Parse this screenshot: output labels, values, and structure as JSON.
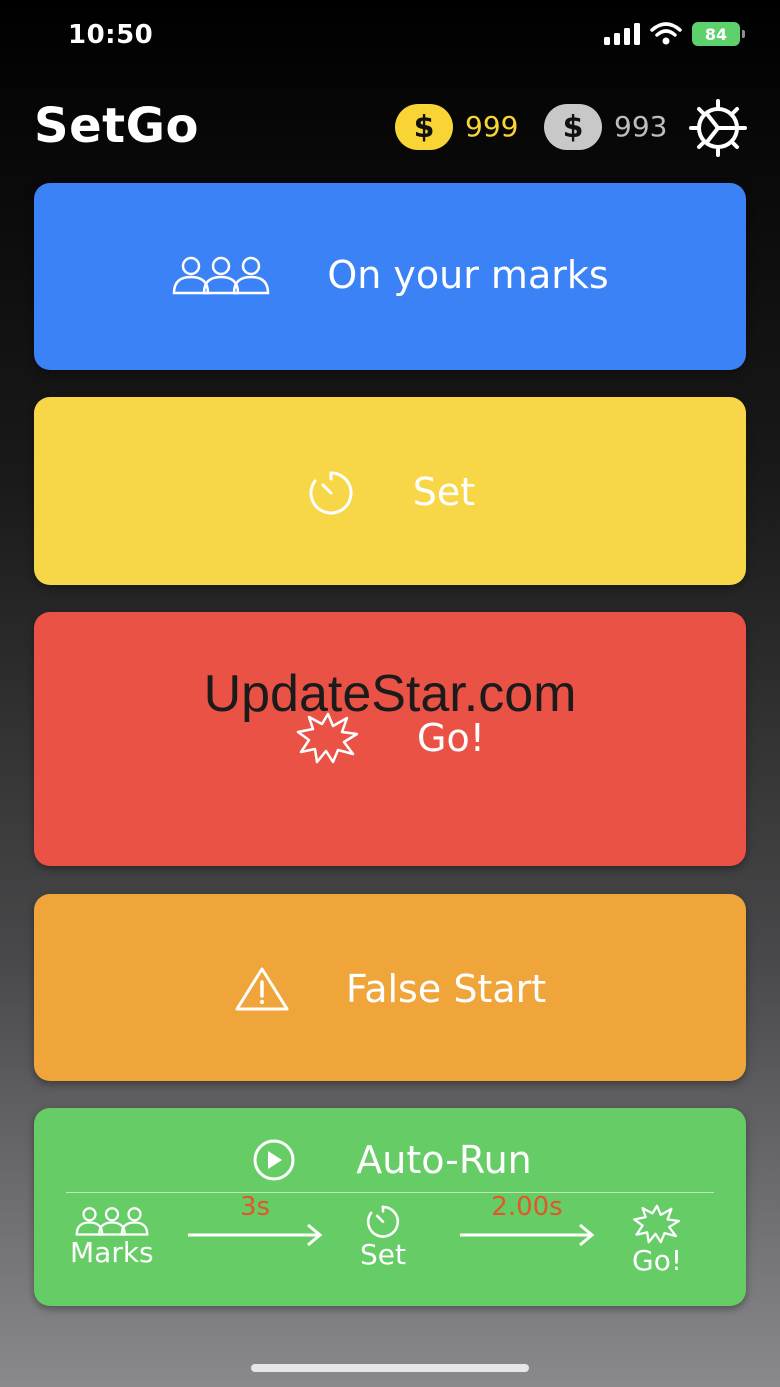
{
  "status_bar": {
    "time": "10:50",
    "battery": "84"
  },
  "header": {
    "title": "SetGo",
    "gold_coins": "999",
    "silver_coins": "993",
    "coin_symbol": "$"
  },
  "buttons": {
    "marks": {
      "label": "On your marks",
      "icon": "people-icon"
    },
    "set": {
      "label": "Set",
      "icon": "timer-icon"
    },
    "go": {
      "label": "Go!",
      "icon": "burst-icon"
    },
    "false_start": {
      "label": "False Start",
      "icon": "warning-icon"
    },
    "auto_run": {
      "label": "Auto-Run",
      "icon": "play-icon"
    }
  },
  "sequence": {
    "marks_label": "Marks",
    "delay1": "3s",
    "set_label": "Set",
    "delay2": "2.00s",
    "go_label": "Go!"
  },
  "watermark": "UpdateStar.com",
  "colors": {
    "blue": "#3b82f6",
    "yellow": "#f7d748",
    "red": "#ea5246",
    "orange": "#f0a53a",
    "green": "#66cd66",
    "delay_text": "#e2562b"
  }
}
